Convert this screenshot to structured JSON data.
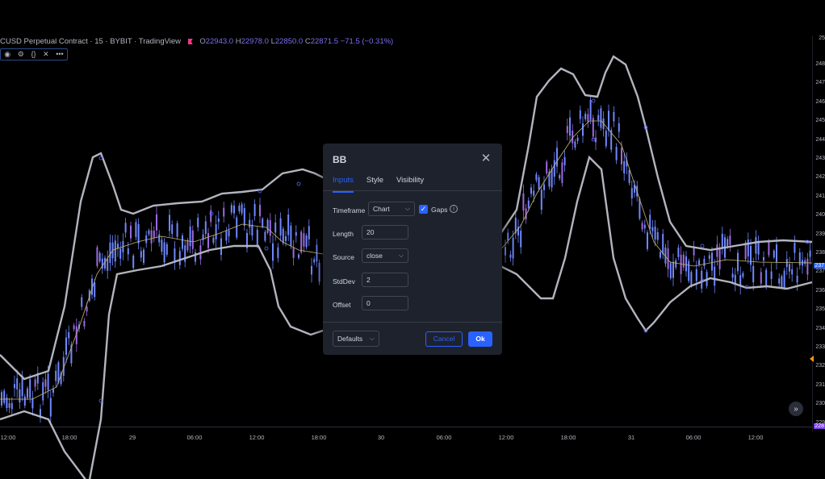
{
  "legend": {
    "title": "CUSD Perpetual Contract · 15 · BYBIT · TradingView",
    "open_label": "O",
    "open": "22943.0",
    "high_label": "H",
    "high": "22978.0",
    "low_label": "L",
    "low": "22850.0",
    "close_label": "C",
    "close": "22871.5",
    "change": "−71.5 (−0.31%)"
  },
  "indicator_toolbar": {
    "icons": [
      "eye-icon",
      "settings-icon",
      "source-code-icon",
      "close-icon",
      "more-icon"
    ],
    "glyphs": [
      "◉",
      "⚙",
      "{}",
      "✕",
      "•••"
    ]
  },
  "price_axis": {
    "ticks": [
      "248",
      "247",
      "246",
      "245",
      "244",
      "243",
      "242",
      "241",
      "240",
      "239",
      "238",
      "237",
      "236",
      "235",
      "234",
      "233",
      "232",
      "231",
      "230",
      "229"
    ],
    "top_partial": "25",
    "current_price_label": "237",
    "bottom_price_label": "228"
  },
  "time_axis": {
    "ticks": [
      "12:00",
      "18:00",
      "29",
      "06:00",
      "12:00",
      "18:00",
      "30",
      "06:00",
      "12:00",
      "18:00",
      "31",
      "06:00",
      "12:00"
    ]
  },
  "chart_data": {
    "type": "candlestick",
    "indicator": "BB",
    "series": [
      {
        "name": "upper"
      },
      {
        "name": "basis"
      },
      {
        "name": "lower"
      }
    ],
    "colors": {
      "candle": "#7088ff",
      "candle_down": "#9c6ade",
      "bands": "#b2b5be",
      "basis": "#c8b46a"
    }
  },
  "dialog": {
    "title": "BB",
    "close_glyph": "✕",
    "tabs": [
      "Inputs",
      "Style",
      "Visibility"
    ],
    "active_tab": "Inputs",
    "timeframe": {
      "label": "Timeframe",
      "value": "Chart"
    },
    "gaps": {
      "label": "Gaps",
      "checked": true,
      "info_glyph": "i"
    },
    "length": {
      "label": "Length",
      "value": "20"
    },
    "source": {
      "label": "Source",
      "value": "close"
    },
    "stddev": {
      "label": "StdDev",
      "value": "2"
    },
    "offset": {
      "label": "Offset",
      "value": "0"
    },
    "defaults_label": "Defaults",
    "cancel_label": "Cancel",
    "ok_label": "Ok"
  },
  "colors": {
    "accent": "#2962ff",
    "background": "#000000",
    "dialog_bg": "#1e222d",
    "flag": "#f23687"
  }
}
